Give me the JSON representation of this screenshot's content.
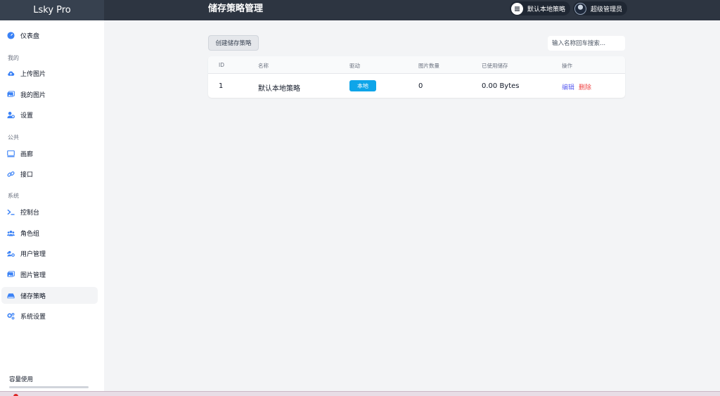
{
  "header": {
    "brand": "Lsky Pro",
    "title": "储存策略管理",
    "policy_label": "默认本地策略",
    "user_label": "超级管理员"
  },
  "sidebar": {
    "dashboard": "仪表盘",
    "group_mine": "我的",
    "upload": "上传图片",
    "my_images": "我的图片",
    "settings": "设置",
    "group_public": "公共",
    "gallery": "画廊",
    "api": "接口",
    "group_system": "系统",
    "console": "控制台",
    "roles": "角色组",
    "users": "用户管理",
    "images": "图片管理",
    "strategies": "储存策略",
    "system_settings": "系统设置",
    "usage_label": "容量使用",
    "usage_fraction": 0
  },
  "toolbar": {
    "create_label": "创建储存策略",
    "search_placeholder": "输入名称回车搜索..."
  },
  "table": {
    "headers": [
      "ID",
      "名称",
      "驱动",
      "图片数量",
      "已使用储存",
      "操作"
    ],
    "rows": [
      {
        "id": "1",
        "name": "默认本地策略",
        "driver": "本地",
        "count": "0",
        "used": "0.00 Bytes",
        "edit": "编辑",
        "delete": "删除"
      }
    ]
  },
  "colors": {
    "topbar": "#2d3541",
    "accent": "#3b82f6",
    "badge": "#0ea5e9",
    "edit": "#6366f1",
    "delete": "#ef4444"
  }
}
